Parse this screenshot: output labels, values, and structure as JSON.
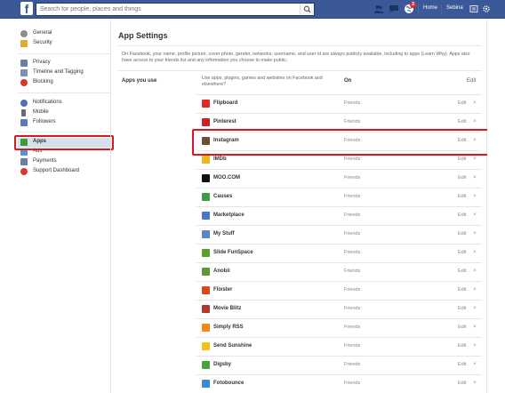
{
  "topbar": {
    "logo": "f",
    "search_placeholder": "Search for people, places and things",
    "notification_count": "3",
    "home_label": "Home",
    "user_name": "Sebina"
  },
  "sidebar": {
    "groups": [
      [
        {
          "label": "General",
          "icon": "gear-icon",
          "color": "#8d8d8d"
        },
        {
          "label": "Security",
          "icon": "shield-icon",
          "color": "#e5a929"
        }
      ],
      [
        {
          "label": "Privacy",
          "icon": "lock-icon",
          "color": "#6b7fa8"
        },
        {
          "label": "Timeline and Tagging",
          "icon": "timeline-icon",
          "color": "#7c8fb5"
        },
        {
          "label": "Blocking",
          "icon": "blocking-icon",
          "color": "#d6392b"
        }
      ],
      [
        {
          "label": "Notifications",
          "icon": "globe-icon",
          "color": "#4e6fb0"
        },
        {
          "label": "Mobile",
          "icon": "mobile-icon",
          "color": "#6c6c6c"
        },
        {
          "label": "Followers",
          "icon": "followers-icon",
          "color": "#5b7bb8"
        }
      ],
      [
        {
          "label": "Apps",
          "icon": "apps-icon",
          "color": "#3c9b3c",
          "active": true
        },
        {
          "label": "Ads",
          "icon": "ads-icon",
          "color": "#5a8fd6"
        },
        {
          "label": "Payments",
          "icon": "payments-icon",
          "color": "#6d7fa5"
        },
        {
          "label": "Support Dashboard",
          "icon": "support-icon",
          "color": "#d63a2f"
        }
      ]
    ]
  },
  "main": {
    "title": "App Settings",
    "intro": "On Facebook, your name, profile picture, cover photo, gender, networks, username, and user id are always publicly available, including to apps (Learn Why). Apps also have access to your friends list and any information you choose to make public.",
    "section_label": "Apps you use",
    "header_desc": "Use apps, plugins, games and websites on Facebook and elsewhere?",
    "header_on": "On",
    "header_edit": "Edit",
    "apps": [
      {
        "name": "Flipboard",
        "visibility": "Friends",
        "edit": "Edit",
        "remove": "×",
        "icon": "flipboard-icon",
        "color": "#e12828"
      },
      {
        "name": "Pinterest",
        "visibility": "Friends",
        "edit": "Edit",
        "remove": "×",
        "icon": "pinterest-icon",
        "color": "#cb2027"
      },
      {
        "name": "Instagram",
        "visibility": "Friends",
        "edit": "Edit",
        "remove": "×",
        "icon": "instagram-icon",
        "color": "#6b4e36"
      },
      {
        "name": "IMDb",
        "visibility": "Friends",
        "edit": "Edit",
        "remove": "×",
        "icon": "imdb-icon",
        "color": "#e8b820"
      },
      {
        "name": "MOO.COM",
        "visibility": "Friends",
        "edit": "Edit",
        "remove": "×",
        "icon": "moo-icon",
        "color": "#111111"
      },
      {
        "name": "Causes",
        "visibility": "Friends",
        "edit": "Edit",
        "remove": "×",
        "icon": "causes-icon",
        "color": "#3e9b46"
      },
      {
        "name": "Marketplace",
        "visibility": "Friends",
        "edit": "Edit",
        "remove": "×",
        "icon": "marketplace-icon",
        "color": "#4a78c4"
      },
      {
        "name": "My Stuff",
        "visibility": "Friends",
        "edit": "Edit",
        "remove": "×",
        "icon": "mystuff-icon",
        "color": "#5c86c9"
      },
      {
        "name": "Slide FunSpace",
        "visibility": "Friends",
        "edit": "Edit",
        "remove": "×",
        "icon": "slide-icon",
        "color": "#5aa02c"
      },
      {
        "name": "Anobii",
        "visibility": "Friends",
        "edit": "Edit",
        "remove": "×",
        "icon": "anobii-icon",
        "color": "#5b9a3b"
      },
      {
        "name": "Flixster",
        "visibility": "Friends",
        "edit": "Edit",
        "remove": "×",
        "icon": "flixster-icon",
        "color": "#d84a1e"
      },
      {
        "name": "Movie Blitz",
        "visibility": "Friends",
        "edit": "Edit",
        "remove": "×",
        "icon": "movieblitz-icon",
        "color": "#b33a2a"
      },
      {
        "name": "Simply RSS",
        "visibility": "Friends",
        "edit": "Edit",
        "remove": "×",
        "icon": "rss-icon",
        "color": "#f08a1c"
      },
      {
        "name": "Send Sunshine",
        "visibility": "Friends",
        "edit": "Edit",
        "remove": "×",
        "icon": "sunshine-icon",
        "color": "#f2c21a"
      },
      {
        "name": "Digsby",
        "visibility": "Friends",
        "edit": "Edit",
        "remove": "×",
        "icon": "digsby-icon",
        "color": "#4aa13e"
      },
      {
        "name": "Fotobounce",
        "visibility": "Friends",
        "edit": "Edit",
        "remove": "×",
        "icon": "fotobounce-icon",
        "color": "#3a8bd4"
      }
    ]
  }
}
